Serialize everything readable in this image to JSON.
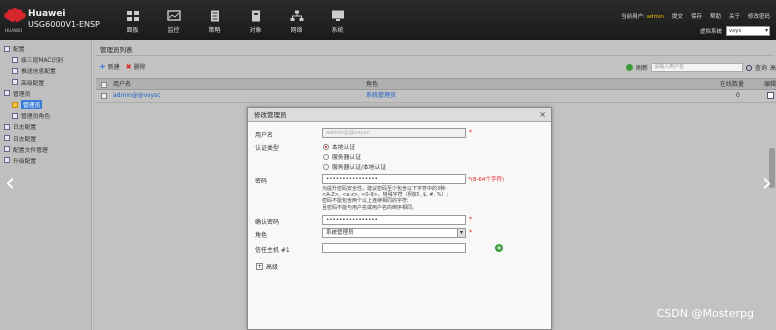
{
  "header": {
    "logo_text": "HUAWEI",
    "brand_line1": "Huawei",
    "brand_line2": "USG6000V1-ENSP",
    "nav": [
      {
        "label": "面板",
        "icon": "dashboard-icon"
      },
      {
        "label": "监控",
        "icon": "monitor-icon"
      },
      {
        "label": "策略",
        "icon": "policy-icon"
      },
      {
        "label": "对象",
        "icon": "object-icon"
      },
      {
        "label": "网络",
        "icon": "network-icon"
      },
      {
        "label": "系统",
        "icon": "system-icon"
      }
    ],
    "current_user_label": "当前用户:",
    "current_user": "admin",
    "links": [
      "提交",
      "保存",
      "帮助",
      "关于",
      "修改密码"
    ],
    "vsys_label": "虚拟系统",
    "vsys_value": "vsys"
  },
  "sidebar": {
    "items": [
      {
        "label": "配置",
        "indent": 0
      },
      {
        "label": "接三层MAC识别",
        "indent": 1
      },
      {
        "label": "推送信息配置",
        "indent": 1
      },
      {
        "label": "高级配置",
        "indent": 1
      },
      {
        "label": "管理员",
        "indent": 0
      },
      {
        "label": "管理员",
        "indent": 1,
        "selected": true
      },
      {
        "label": "管理员角色",
        "indent": 1
      },
      {
        "label": "日志配置",
        "indent": 0
      },
      {
        "label": "日志配置",
        "indent": 0
      },
      {
        "label": "配置文件管理",
        "indent": 0
      },
      {
        "label": "升级配置",
        "indent": 0
      }
    ]
  },
  "main": {
    "title": "管理员列表",
    "new_label": "新建",
    "delete_label": "删除",
    "refresh_label": "刷新",
    "search_placeholder": "请输入用户名",
    "query_label": "查询",
    "more_label": "高",
    "columns": {
      "user": "用户名",
      "role": "角色",
      "online": "在线数量",
      "edit": "编辑"
    },
    "rows": [
      {
        "user": "admin@@vsysc",
        "role": "系统管理员",
        "online": "0"
      }
    ]
  },
  "dialog": {
    "title": "修改管理员",
    "close": "×",
    "username_label": "用户名",
    "username_value": "admin@@vsysc",
    "auth_label": "认证类型",
    "auth_options": [
      {
        "label": "本地认证",
        "checked": true
      },
      {
        "label": "服务器认证",
        "checked": false
      },
      {
        "label": "服务器认证/本地认证",
        "checked": false
      }
    ],
    "password_label": "密码",
    "password_value": "••••••••••••••••",
    "password_note": "*(8-64个字符)",
    "hint_lines": [
      "为提升密码安全性，建议密码至少包含以下字符中的3种:",
      "<A-Z>, <a-z>, <0-9>，特殊字符（例如!, $, #, %）;",
      "密码不能包含两个以上连续相同的字符;",
      "且密码不能与用户名或用户名的倒序相同。"
    ],
    "confirm_label": "确认密码",
    "confirm_value": "••••••••••••••••",
    "role_label": "角色",
    "role_value": "系统管理员",
    "trusted_host_label": "信任主机 #1",
    "trusted_host_value": "",
    "advanced_label": "高级"
  },
  "watermark": "CSDN @Mosterpg",
  "colors": {
    "accent": "#1b5fc4",
    "required": "#d22222",
    "header_bg": "#222222"
  }
}
